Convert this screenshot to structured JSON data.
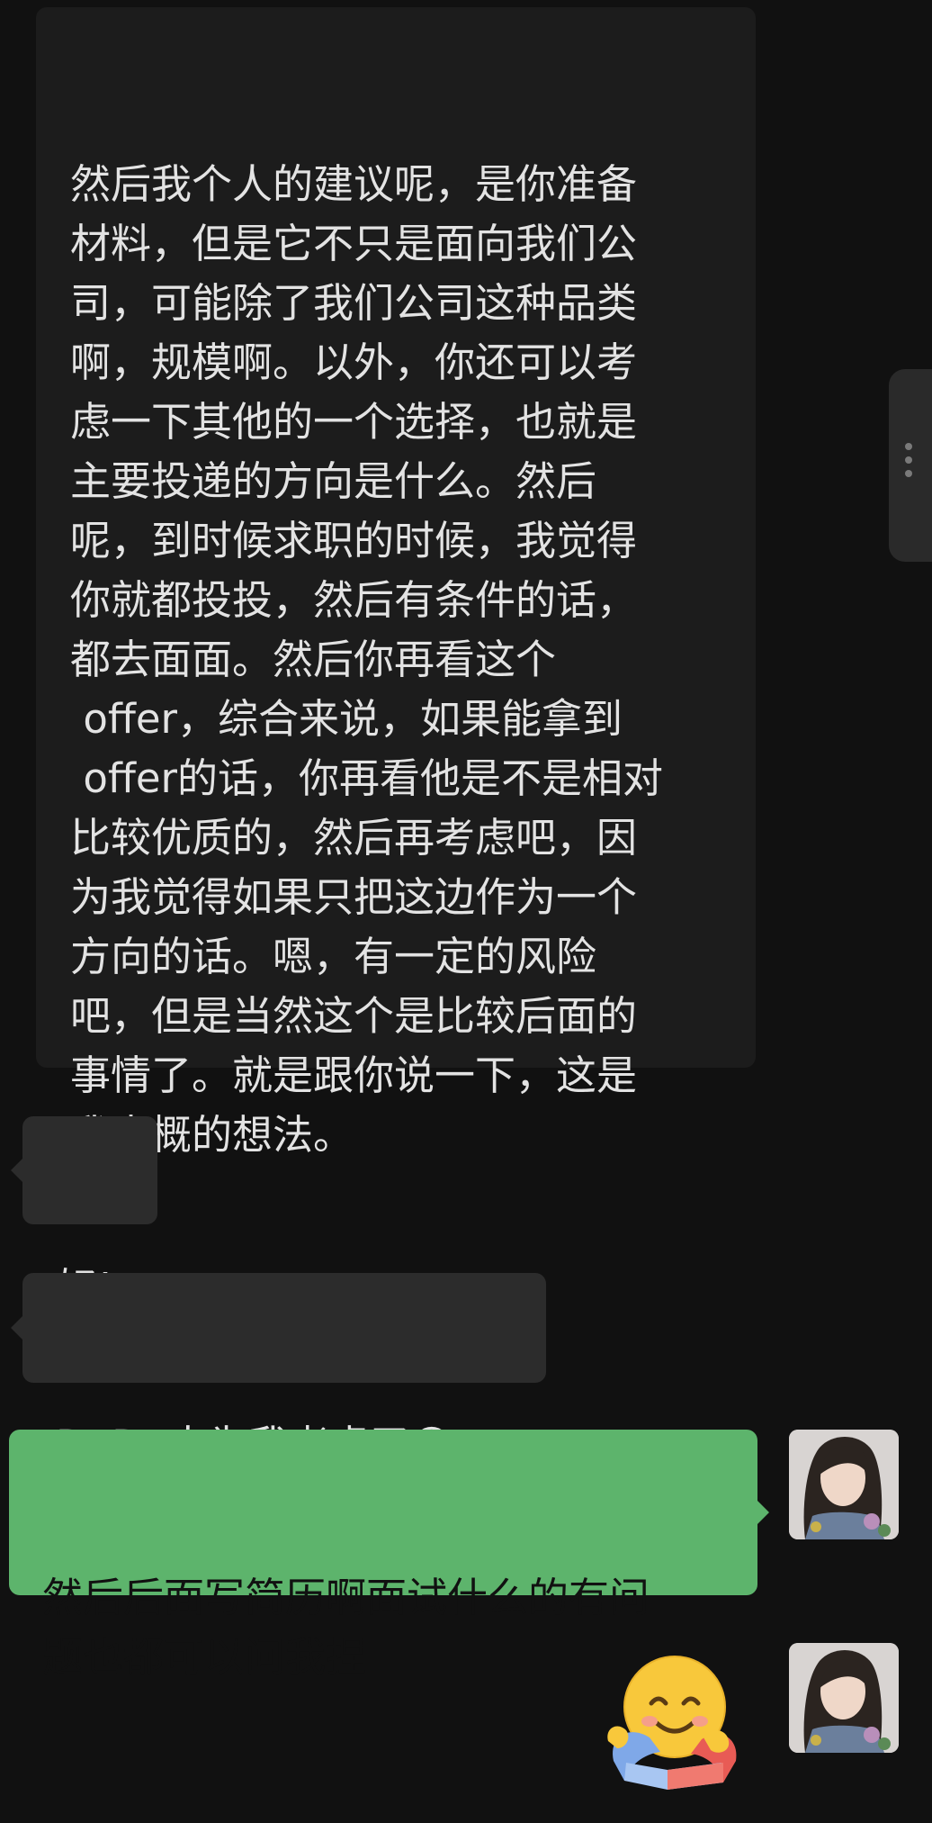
{
  "messages": [
    {
      "sender": "other",
      "text": "然后我个人的建议呢，是你准备\n材料，但是它不只是面向我们公\n司，可能除了我们公司这种品类\n啊，规模啊。以外，你还可以考\n虑一下其他的一个选择，也就是\n主要投递的方向是什么。然后\n呢，到时候求职的时候，我觉得\n你就都投投，然后有条件的话，\n都去面面。然后你再看这个\n offer，综合来说，如果能拿到\n offer的话，你再看他是不是相对\n比较优质的，然后再考虑吧，因\n为我觉得如果只把这边作为一个\n方向的话。嗯，有一定的风险\n吧，但是当然这个是比较后面的\n事情了。就是跟你说一下，这是\n我大概的想法。"
    },
    {
      "sender": "other",
      "text": "好!"
    },
    {
      "sender": "other",
      "text": "DoDo太为我考虑了😚"
    },
    {
      "sender": "me",
      "text": "然后后面写简历啊面试什么的有问\n题也都可以问我捏"
    },
    {
      "sender": "me",
      "sticker": "hugging-face-sticker"
    }
  ],
  "colors": {
    "background": "#111111",
    "incoming_bubble": "#2c2c2c",
    "outgoing_bubble": "#5db46c",
    "text": "#e3e3e3"
  },
  "icons": {
    "side_handle": "more-vertical-icon",
    "sticker": "hugging-face-emoji"
  }
}
